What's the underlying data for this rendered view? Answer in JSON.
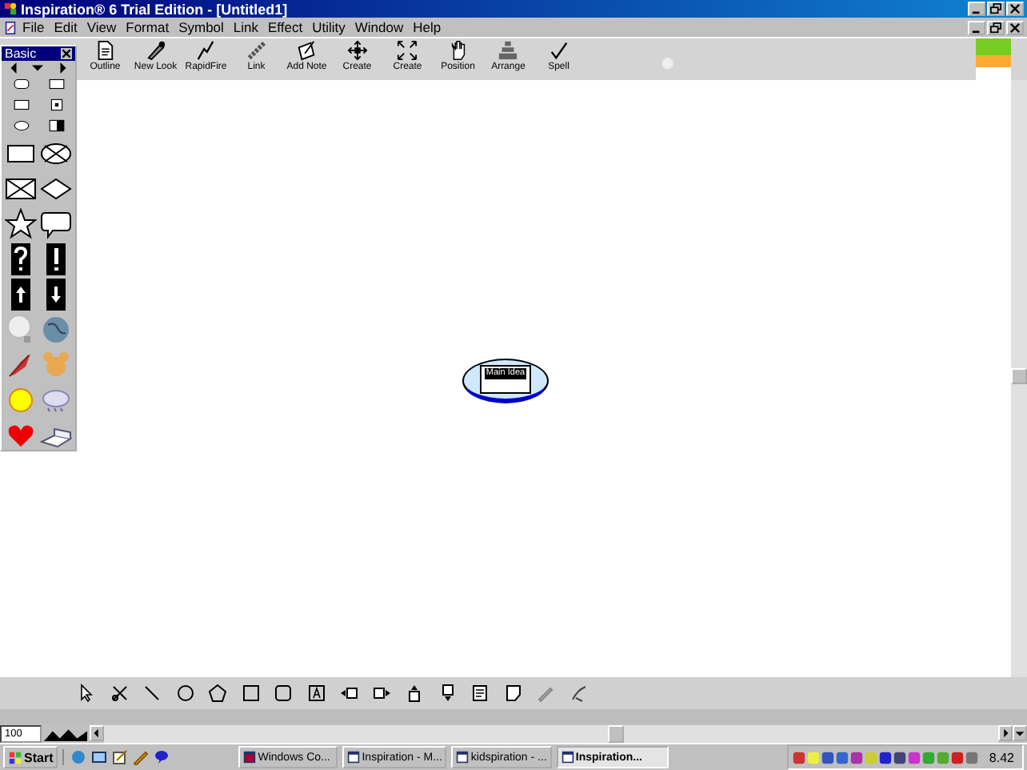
{
  "window": {
    "title": "Inspiration® 6 Trial Edition - [Untitled1]"
  },
  "menu": [
    "File",
    "Edit",
    "View",
    "Format",
    "Symbol",
    "Link",
    "Effect",
    "Utility",
    "Window",
    "Help"
  ],
  "toolbar": [
    {
      "label": "Outline",
      "kind": "outline"
    },
    {
      "label": "New Look",
      "kind": "newlook"
    },
    {
      "label": "RapidFire",
      "kind": "rapidfire"
    },
    {
      "label": "Link",
      "kind": "link"
    },
    {
      "label": "Add Note",
      "kind": "note"
    },
    {
      "label": "Create",
      "kind": "create"
    },
    {
      "label": "Create",
      "kind": "create2"
    },
    {
      "label": "Position",
      "kind": "position"
    },
    {
      "label": "Arrange",
      "kind": "arrange"
    },
    {
      "label": "Spell",
      "kind": "spell"
    }
  ],
  "palette": {
    "title": "Basic"
  },
  "canvas": {
    "node": {
      "text": "Main Idea",
      "selected": true
    }
  },
  "zoom": {
    "value": "100"
  },
  "taskbar": {
    "start": "Start",
    "tasks": [
      {
        "label": "Windows Co...",
        "selected": false
      },
      {
        "label": "Inspiration - M...",
        "selected": false
      },
      {
        "label": "kidspiration - ...",
        "selected": false
      },
      {
        "label": "Inspiration...",
        "selected": true
      }
    ],
    "clock": "8.42"
  }
}
